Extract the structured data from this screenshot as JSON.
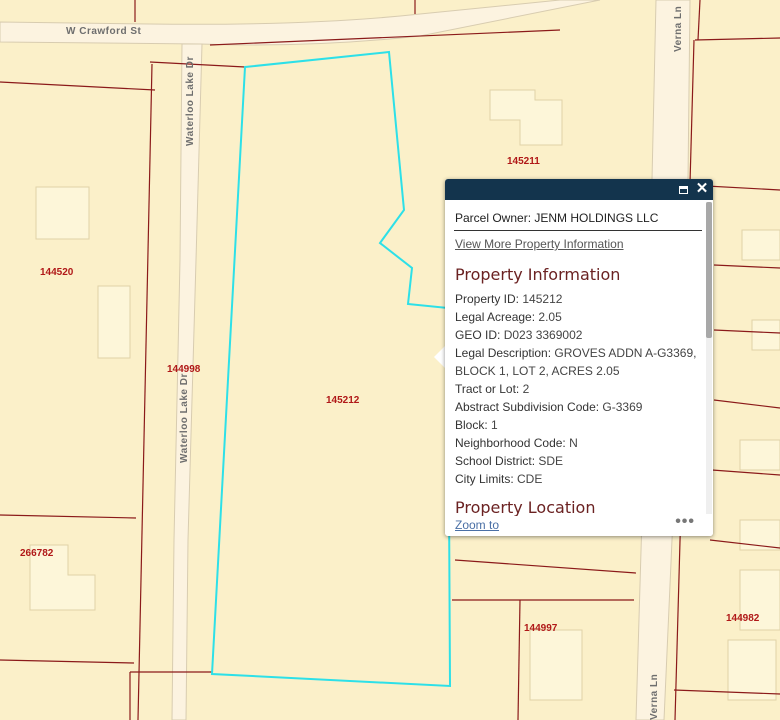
{
  "map": {
    "streets": {
      "crawford": "W Crawford St",
      "waterloo_top": "Waterloo Lake Dr",
      "waterloo_bottom": "Waterloo Lake Dr",
      "verna_top": "Verna Ln",
      "verna_bottom": "Verna Ln"
    },
    "parcels": {
      "p145211": "145211",
      "p144520": "144520",
      "p144998": "144998",
      "p145212": "145212",
      "p266782": "266782",
      "p144997": "144997",
      "p144982": "144982"
    },
    "colors": {
      "background": "#fbf0c9",
      "parcel_line": "#8b1a1a",
      "selection": "#2de0e8",
      "road": "#fcf3e0",
      "building": "#fdf6d9"
    }
  },
  "popup": {
    "owner_label": "Parcel Owner:",
    "owner_value": "JENM HOLDINGS LLC",
    "more_link": "View More Property Information",
    "section1": "Property Information",
    "fields": [
      {
        "label": "Property ID:",
        "value": "145212"
      },
      {
        "label": "Legal Acreage:",
        "value": "2.05"
      },
      {
        "label": "GEO ID:",
        "value": "D023 3369002"
      },
      {
        "label": "Legal Description:",
        "value": "GROVES ADDN A-G3369, BLOCK 1, LOT 2, ACRES 2.05"
      },
      {
        "label": "Tract or Lot:",
        "value": "2"
      },
      {
        "label": "Abstract Subdivision Code:",
        "value": "G-3369"
      },
      {
        "label": "Block:",
        "value": "1"
      },
      {
        "label": "Neighborhood Code:",
        "value": "N"
      },
      {
        "label": "School District:",
        "value": "SDE"
      },
      {
        "label": "City Limits:",
        "value": "CDE"
      }
    ],
    "section2": "Property Location",
    "zoom_link": "Zoom to",
    "more_icon": "ellipsis-icon",
    "maximize_icon": "maximize-icon",
    "close_icon": "close-icon",
    "close_glyph": "✕",
    "dots_glyph": "•••",
    "header_color": "#13344d"
  }
}
